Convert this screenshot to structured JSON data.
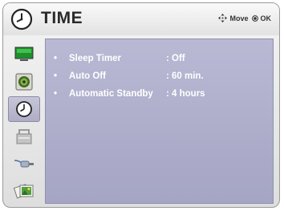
{
  "header": {
    "title": "TIME",
    "nav_move_label": "Move",
    "nav_ok_label": "OK"
  },
  "sidebar": {
    "items": [
      {
        "icon": "picture-icon",
        "label": "Picture",
        "selected": false
      },
      {
        "icon": "audio-icon",
        "label": "Audio",
        "selected": false
      },
      {
        "icon": "clock-icon",
        "label": "Time",
        "selected": true
      },
      {
        "icon": "lock-icon",
        "label": "Lock",
        "selected": false
      },
      {
        "icon": "input-icon",
        "label": "Input",
        "selected": false
      },
      {
        "icon": "photo-icon",
        "label": "Photos",
        "selected": false
      }
    ]
  },
  "settings": {
    "items": [
      {
        "bullet": "•",
        "label": "Sleep Timer",
        "value": ": Off"
      },
      {
        "bullet": "•",
        "label": "Auto Off",
        "value": ": 60 min."
      },
      {
        "bullet": "•",
        "label": "Automatic Standby",
        "value": ": 4 hours"
      }
    ]
  },
  "colors": {
    "content_bg": "#b2b2cc",
    "selected_bg": "#b9b8d0",
    "text_white": "#ffffff"
  }
}
